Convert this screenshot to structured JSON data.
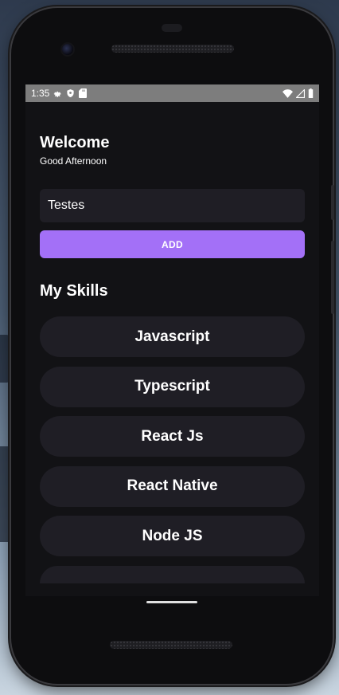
{
  "status_bar": {
    "time": "1:35",
    "left_icons": [
      "gear-icon",
      "shield-icon",
      "sd-card-icon"
    ],
    "right_icons": [
      "wifi-icon",
      "cell-signal-icon",
      "battery-icon"
    ]
  },
  "header": {
    "title": "Welcome",
    "greeting": "Good Afternoon"
  },
  "form": {
    "input_value": "Testes",
    "add_label": "ADD"
  },
  "skills": {
    "title": "My Skills",
    "items": [
      {
        "label": "Javascript"
      },
      {
        "label": "Typescript"
      },
      {
        "label": "React Js"
      },
      {
        "label": "React Native"
      },
      {
        "label": "Node JS"
      }
    ]
  },
  "colors": {
    "screen_bg": "#121215",
    "card_bg": "#1f1e25",
    "accent": "#a370f7",
    "text": "#ffffff",
    "status_bar_bg": "#7d7d7d"
  }
}
